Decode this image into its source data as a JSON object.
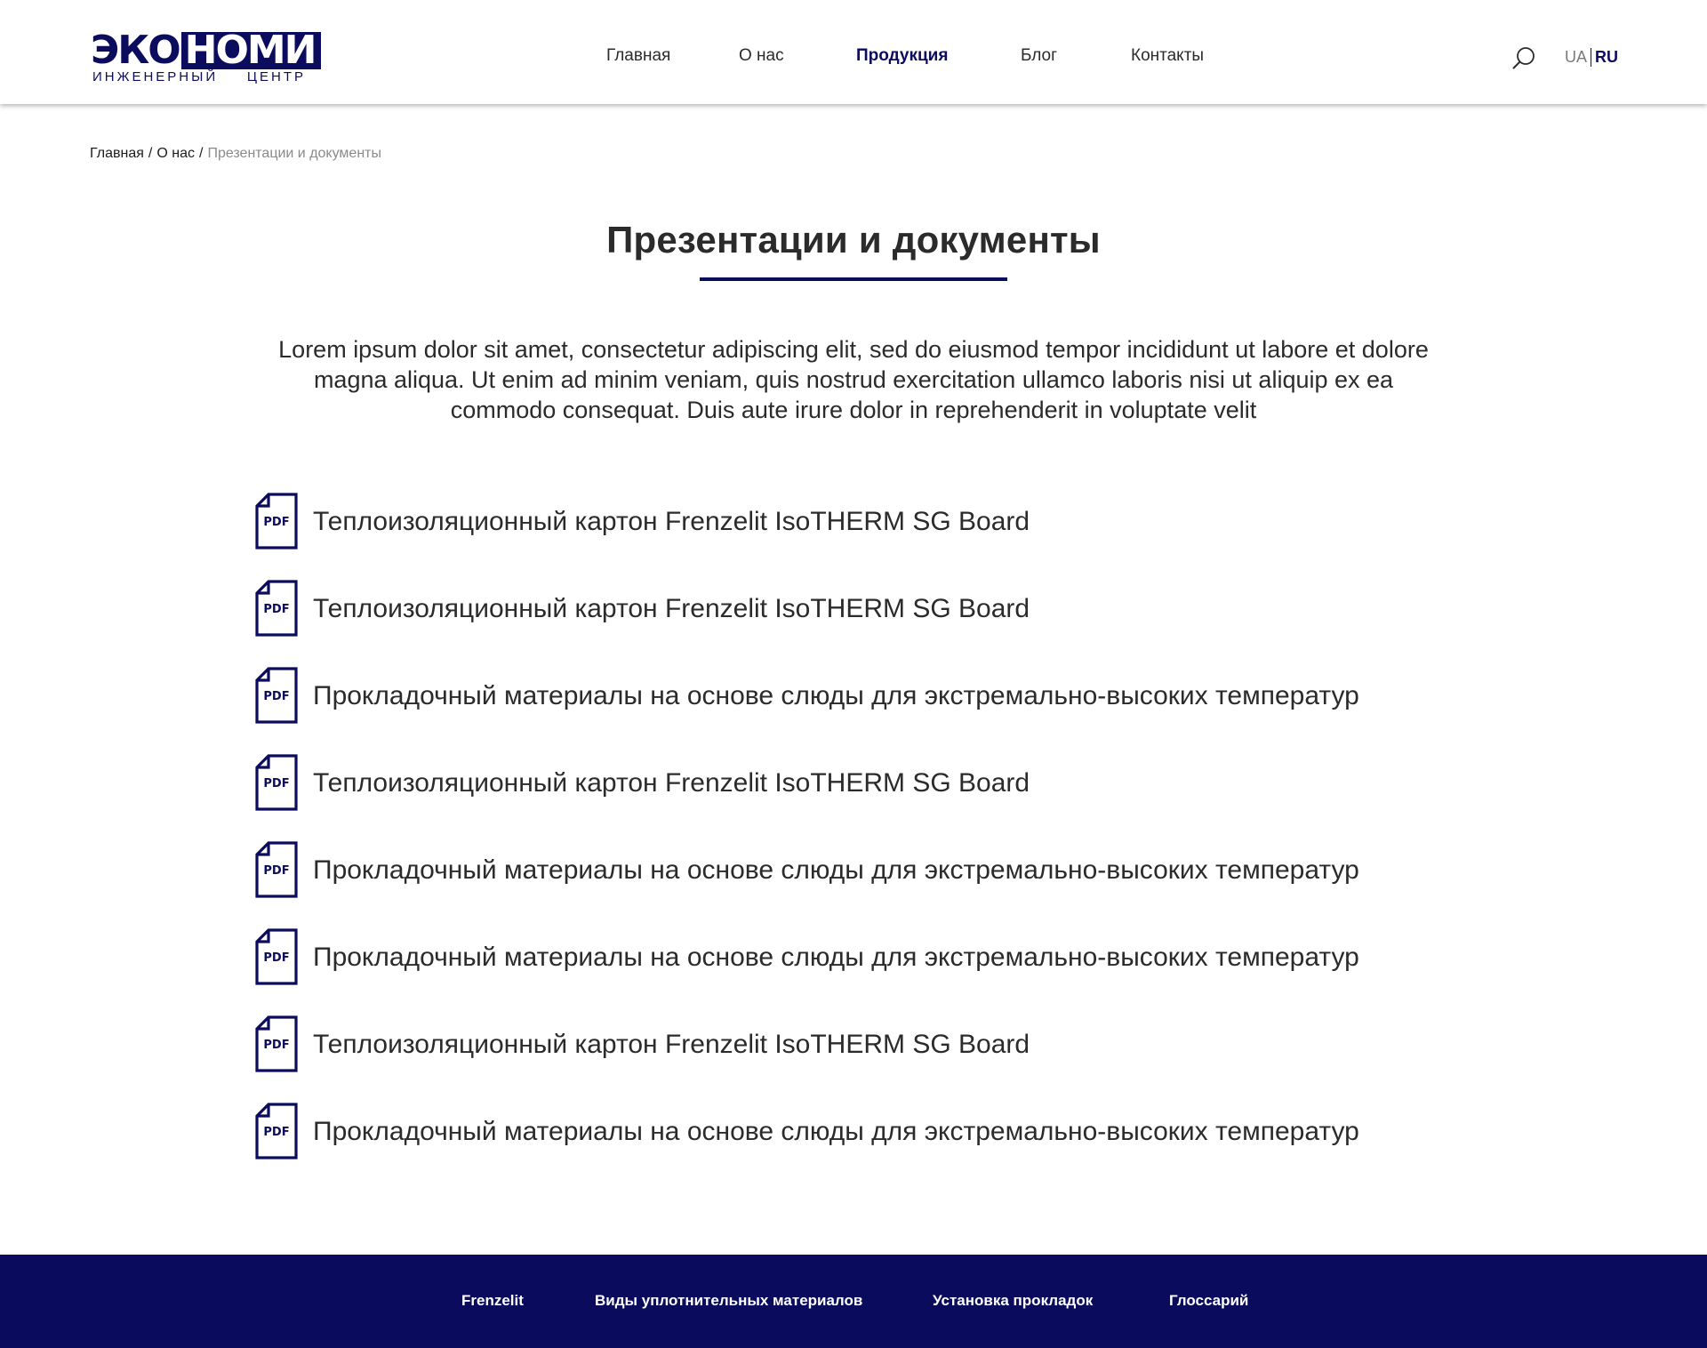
{
  "colors": {
    "brand": "#0c0c5e",
    "text": "#2b2b2b",
    "muted": "#8a8a8a",
    "footer_bg": "#0b0b5e"
  },
  "logo": {
    "part1": "ЭКО",
    "part2": "НОМИ",
    "sub_left": "ИНЖЕНЕРНЫЙ",
    "sub_right": "ЦЕНТР"
  },
  "nav": {
    "items": [
      {
        "label": "Главная"
      },
      {
        "label": "О нас"
      },
      {
        "label": "Продукция",
        "active": true
      },
      {
        "label": "Блог"
      },
      {
        "label": "Контакты"
      }
    ]
  },
  "header_tools": {
    "search_icon": "search-icon",
    "lang_ua": "UA",
    "lang_ru": "RU",
    "lang_active": "RU"
  },
  "breadcrumb": {
    "items": [
      "Главная",
      "О нас"
    ],
    "current": "Презентации и документы",
    "separator": "/"
  },
  "page": {
    "title": "Презентации и документы",
    "intro": "Lorem ipsum dolor sit amet, consectetur adipiscing elit, sed do eiusmod tempor incididunt ut labore et dolore magna aliqua. Ut enim ad minim veniam, quis nostrud exercitation ullamco laboris nisi ut aliquip ex ea commodo consequat. Duis aute irure dolor in reprehenderit in voluptate velit"
  },
  "documents": {
    "icon_label": "PDF",
    "items": [
      {
        "title": "Теплоизоляционный картон Frenzelit IsoTHERM SG Board"
      },
      {
        "title": "Теплоизоляционный картон Frenzelit IsoTHERM SG Board"
      },
      {
        "title": "Прокладочный материалы на основе слюды для экстремально-высоких температур"
      },
      {
        "title": "Теплоизоляционный картон Frenzelit IsoTHERM SG Board"
      },
      {
        "title": "Прокладочный материалы на основе слюды для экстремально-высоких температур"
      },
      {
        "title": "Прокладочный материалы на основе слюды для экстремально-высоких температур"
      },
      {
        "title": "Теплоизоляционный картон Frenzelit IsoTHERM SG Board"
      },
      {
        "title": "Прокладочный материалы на основе слюды для экстремально-высоких температур"
      }
    ]
  },
  "footer": {
    "links": [
      {
        "label": "Frenzelit"
      },
      {
        "label": "Виды уплотнительных материалов"
      },
      {
        "label": "Установка прокладок"
      },
      {
        "label": "Глоссарий"
      }
    ]
  }
}
